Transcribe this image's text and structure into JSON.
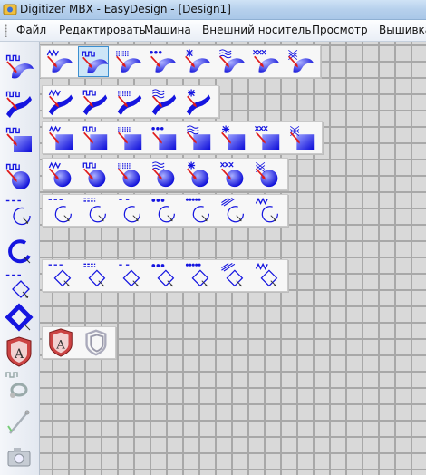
{
  "window": {
    "title": "Digitizer MBX - EasyDesign - [Design1]"
  },
  "menu": {
    "items": [
      "Файл",
      "Редактировать",
      "Машина",
      "Внешний носитель",
      "Просмотр",
      "Вышивка"
    ]
  },
  "left_toolbar": {
    "tools": [
      "fill-area-square-icon",
      "fill-area-band-icon",
      "fill-area-square-block-icon",
      "fill-area-circle-icon",
      "outline-circle-icon",
      "blue-arc-icon",
      "outline-diamond-icon",
      "diamond-shape-icon",
      "appliqué-shield-icon",
      "scissors-icon",
      "needle-icon",
      "camera-icon"
    ]
  },
  "flyouts": {
    "row1": [
      "zigzag",
      "square-wave",
      "dotted",
      "stars",
      "asterisk",
      "waves",
      "cross-x",
      "mesh"
    ],
    "row2": [
      "zigzag",
      "square-wave",
      "dotted",
      "waves",
      "asterisk"
    ],
    "row3": [
      "zigzag",
      "square-wave",
      "dotted",
      "stars",
      "waves",
      "asterisk",
      "cross-x",
      "mesh"
    ],
    "row4": [
      "zigzag",
      "square-wave",
      "dotted",
      "waves",
      "asterisk",
      "cross-x",
      "mesh"
    ],
    "row5": [
      "dashed",
      "double-dash",
      "short-dash",
      "stars",
      "dense-stars",
      "slashes",
      "zigzag"
    ],
    "row6": [
      "dashed",
      "double-dash",
      "short-dash",
      "stars",
      "dense-stars",
      "slashes",
      "zigzag"
    ],
    "row7": [
      "shield-a",
      "shield-outline"
    ]
  },
  "colors": {
    "accent_blue": "#1515e0",
    "arrow_red": "#e01b1b",
    "shield_red": "#c44",
    "canvas": "#d9d9d9"
  }
}
